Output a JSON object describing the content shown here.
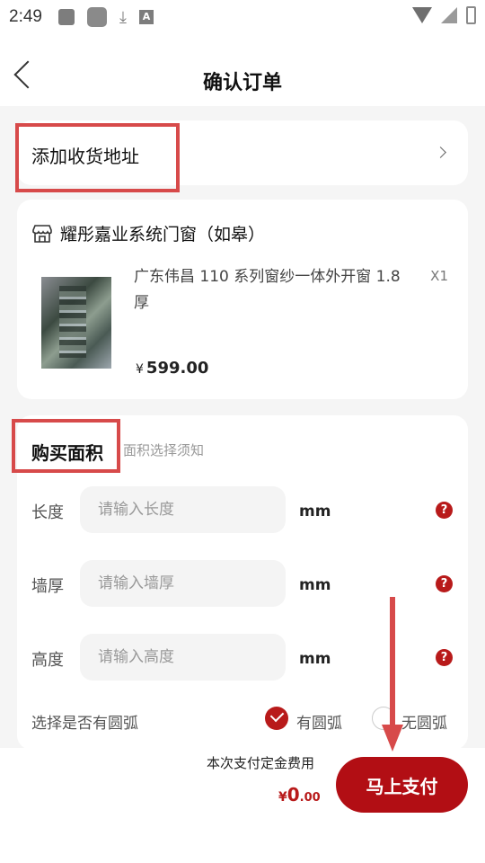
{
  "status_bar": {
    "time": "2:49",
    "icons": [
      "image-icon",
      "app-icon",
      "download-icon",
      "a-icon",
      "wifi-icon",
      "signal-icon",
      "battery-icon"
    ]
  },
  "header": {
    "title": "确认订单"
  },
  "address": {
    "label": "添加收货地址"
  },
  "product": {
    "store_name": "耀彤嘉业系统门窗（如皋）",
    "name": "广东伟昌 110 系列窗纱一体外开窗 1.8 厚",
    "quantity": "X1",
    "currency": "¥",
    "price": "599.00"
  },
  "area": {
    "title": "购买面积",
    "hint": "面积选择须知",
    "rows": [
      {
        "label": "长度",
        "placeholder": "请输入长度",
        "unit": "mm"
      },
      {
        "label": "墙厚",
        "placeholder": "请输入墙厚",
        "unit": "mm"
      },
      {
        "label": "高度",
        "placeholder": "请输入高度",
        "unit": "mm"
      }
    ],
    "help_glyph": "?",
    "arc_label": "选择是否有圆弧",
    "arc_options": [
      "有圆弧",
      "无圆弧"
    ],
    "arc_selected": "有圆弧"
  },
  "footer": {
    "deposit_label": "本次支付定金费用",
    "currency": "¥",
    "amount_int": "0",
    "amount_dec": ".00",
    "pay_button": "马上支付"
  },
  "colors": {
    "accent": "#b20e14",
    "annotation": "#d74a4a"
  }
}
